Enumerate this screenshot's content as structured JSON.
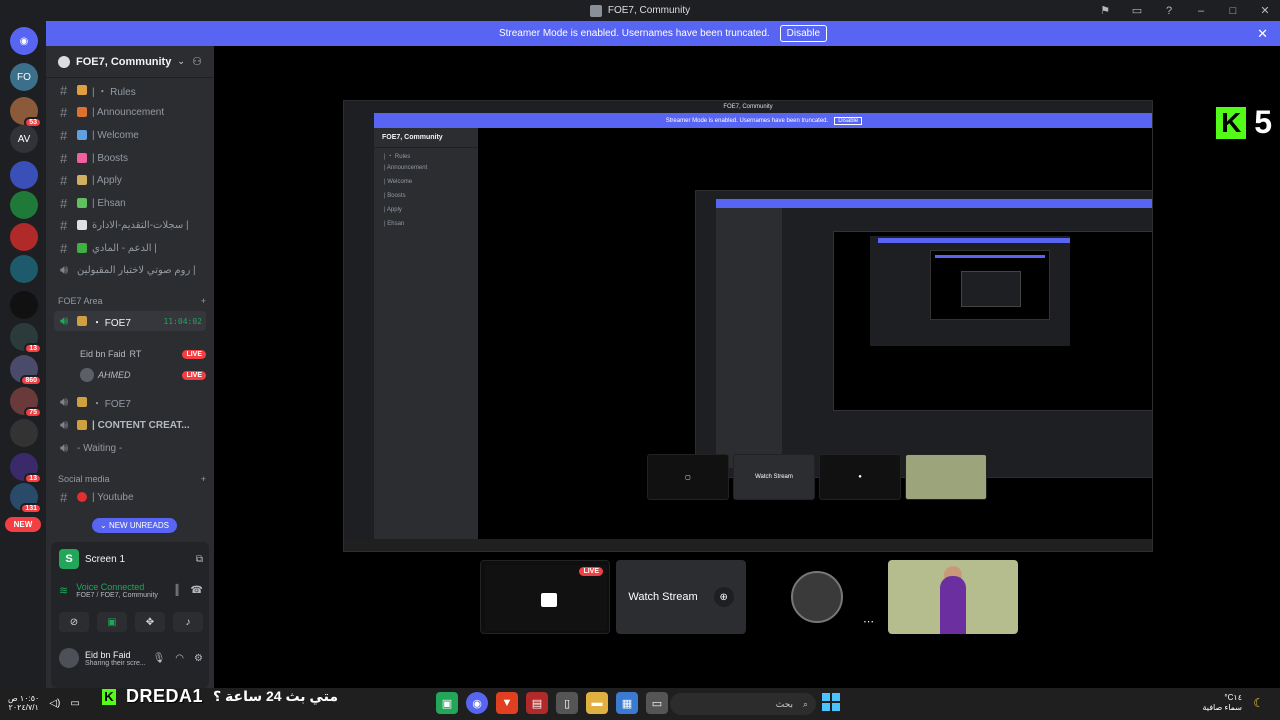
{
  "window": {
    "title": "FOE7, Community"
  },
  "banner": {
    "text": "Streamer Mode is enabled. Usernames have been truncated.",
    "disable_label": "Disable"
  },
  "rail": {
    "servers": [
      {
        "label": "FO",
        "badge": ""
      },
      {
        "label": "",
        "badge": "53"
      },
      {
        "label": "AV",
        "badge": ""
      },
      {
        "label": "",
        "badge": ""
      },
      {
        "label": "",
        "badge": ""
      },
      {
        "label": "",
        "badge": ""
      },
      {
        "label": "",
        "badge": ""
      },
      {
        "label": "",
        "badge": ""
      },
      {
        "label": "",
        "badge": "13"
      },
      {
        "label": "",
        "badge": "860"
      },
      {
        "label": "",
        "badge": "75"
      },
      {
        "label": "",
        "badge": ""
      },
      {
        "label": "",
        "badge": "13"
      },
      {
        "label": "",
        "badge": "131"
      }
    ],
    "new_label": "NEW"
  },
  "guild": {
    "name": "FOE7, Community"
  },
  "channels": [
    {
      "name": "| ・ Rules"
    },
    {
      "name": "| Announcement"
    },
    {
      "name": "| Welcome"
    },
    {
      "name": "| Boosts"
    },
    {
      "name": "| Apply"
    },
    {
      "name": "| Ehsan"
    },
    {
      "name": "سجلات-التقديم-الادارة |"
    },
    {
      "name": "الدعم - المادي |"
    },
    {
      "name": "روم صوتي لاختبار المقبولين |"
    }
  ],
  "category_foe7": "FOE7 Area",
  "voice": {
    "active": {
      "name": "・ FOE7",
      "timer": "11:04:02"
    },
    "users": [
      {
        "name": "Eid bn Faid",
        "tag": "RT",
        "live": "LIVE"
      },
      {
        "name": "AHMED",
        "tag": "",
        "live": "LIVE"
      }
    ],
    "others": [
      {
        "name": "・ FOE7"
      },
      {
        "name": "| CONTENT CREAT..."
      },
      {
        "name": "- Waiting -"
      }
    ]
  },
  "category_social": "Social media",
  "social": [
    {
      "name": "| Youtube"
    }
  ],
  "new_unreads": "NEW UNREADS",
  "panel": {
    "screen_title": "Screen 1",
    "vc_title": "Voice Connected",
    "vc_sub": "FOE7 / FOE7, Community",
    "user_name": "Eid bn Faid",
    "user_status": "Sharing their scre..."
  },
  "stage": {
    "k5_number": "5",
    "watch_label": "Watch Stream",
    "live_label": "LIVE"
  },
  "taskbar": {
    "overlay_name": "DREDA1",
    "overlay_arabic": "متي بث 24 ساعة ؟",
    "search_placeholder": "بحث",
    "weather_temp": "°C١٤",
    "weather_desc": "سماء صافية",
    "time": "١٠:٥٠ ص",
    "date": "٢٠٢٤/٧/١"
  },
  "colors": {
    "accent": "#5865f2",
    "live": "#f23f43",
    "online": "#23a55a",
    "kick": "#53fc18"
  }
}
